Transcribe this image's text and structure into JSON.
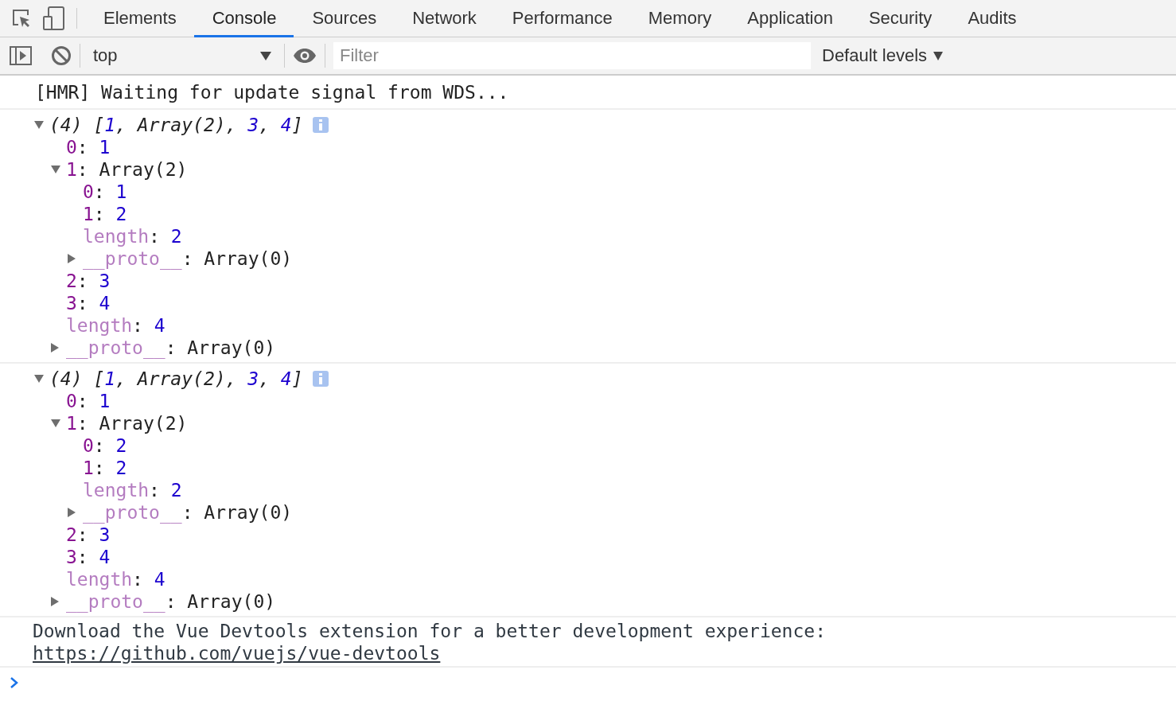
{
  "tabs": [
    {
      "label": "Elements",
      "selected": false
    },
    {
      "label": "Console",
      "selected": true
    },
    {
      "label": "Sources",
      "selected": false
    },
    {
      "label": "Network",
      "selected": false
    },
    {
      "label": "Performance",
      "selected": false
    },
    {
      "label": "Memory",
      "selected": false
    },
    {
      "label": "Application",
      "selected": false
    },
    {
      "label": "Security",
      "selected": false
    },
    {
      "label": "Audits",
      "selected": false
    }
  ],
  "toolbar": {
    "context": "top",
    "filter": {
      "placeholder": "Filter"
    },
    "levels": "Default levels"
  },
  "messages": [
    {
      "kind": "log",
      "text": "[HMR] Waiting for update signal from WDS..."
    },
    {
      "kind": "object",
      "expanded": true,
      "summary": [
        {
          "kind": "punct",
          "text": "(4) ["
        },
        {
          "kind": "number",
          "text": "1"
        },
        {
          "kind": "punct",
          "text": ", "
        },
        {
          "kind": "object",
          "text": "Array(2)"
        },
        {
          "kind": "punct",
          "text": ", "
        },
        {
          "kind": "number",
          "text": "3"
        },
        {
          "kind": "punct",
          "text": ", "
        },
        {
          "kind": "number",
          "text": "4"
        },
        {
          "kind": "punct",
          "text": "]"
        }
      ],
      "children": [
        {
          "parts": [
            {
              "kind": "key",
              "text": "0"
            },
            {
              "kind": "punct",
              "text": ": "
            },
            {
              "kind": "number",
              "text": "1"
            }
          ]
        },
        {
          "expanded": true,
          "parts": [
            {
              "kind": "key",
              "text": "1"
            },
            {
              "kind": "punct",
              "text": ": "
            },
            {
              "kind": "object",
              "text": "Array(2)"
            }
          ],
          "children": [
            {
              "parts": [
                {
                  "kind": "key",
                  "text": "0"
                },
                {
                  "kind": "punct",
                  "text": ": "
                },
                {
                  "kind": "number",
                  "text": "1"
                }
              ]
            },
            {
              "parts": [
                {
                  "kind": "key",
                  "text": "1"
                },
                {
                  "kind": "punct",
                  "text": ": "
                },
                {
                  "kind": "number",
                  "text": "2"
                }
              ]
            },
            {
              "parts": [
                {
                  "kind": "hidden_key",
                  "text": "length"
                },
                {
                  "kind": "punct",
                  "text": ": "
                },
                {
                  "kind": "number",
                  "text": "2"
                }
              ]
            },
            {
              "expanded": false,
              "parts": [
                {
                  "kind": "hidden_key",
                  "text": "__proto__"
                },
                {
                  "kind": "punct",
                  "text": ": "
                },
                {
                  "kind": "object",
                  "text": "Array(0)"
                }
              ]
            }
          ]
        },
        {
          "parts": [
            {
              "kind": "key",
              "text": "2"
            },
            {
              "kind": "punct",
              "text": ": "
            },
            {
              "kind": "number",
              "text": "3"
            }
          ]
        },
        {
          "parts": [
            {
              "kind": "key",
              "text": "3"
            },
            {
              "kind": "punct",
              "text": ": "
            },
            {
              "kind": "number",
              "text": "4"
            }
          ]
        },
        {
          "parts": [
            {
              "kind": "hidden_key",
              "text": "length"
            },
            {
              "kind": "punct",
              "text": ": "
            },
            {
              "kind": "number",
              "text": "4"
            }
          ]
        },
        {
          "expanded": false,
          "parts": [
            {
              "kind": "hidden_key",
              "text": "__proto__"
            },
            {
              "kind": "punct",
              "text": ": "
            },
            {
              "kind": "object",
              "text": "Array(0)"
            }
          ]
        }
      ]
    },
    {
      "kind": "object",
      "expanded": true,
      "summary": [
        {
          "kind": "punct",
          "text": "(4) ["
        },
        {
          "kind": "number",
          "text": "1"
        },
        {
          "kind": "punct",
          "text": ", "
        },
        {
          "kind": "object",
          "text": "Array(2)"
        },
        {
          "kind": "punct",
          "text": ", "
        },
        {
          "kind": "number",
          "text": "3"
        },
        {
          "kind": "punct",
          "text": ", "
        },
        {
          "kind": "number",
          "text": "4"
        },
        {
          "kind": "punct",
          "text": "]"
        }
      ],
      "children": [
        {
          "parts": [
            {
              "kind": "key",
              "text": "0"
            },
            {
              "kind": "punct",
              "text": ": "
            },
            {
              "kind": "number",
              "text": "1"
            }
          ]
        },
        {
          "expanded": true,
          "parts": [
            {
              "kind": "key",
              "text": "1"
            },
            {
              "kind": "punct",
              "text": ": "
            },
            {
              "kind": "object",
              "text": "Array(2)"
            }
          ],
          "children": [
            {
              "parts": [
                {
                  "kind": "key",
                  "text": "0"
                },
                {
                  "kind": "punct",
                  "text": ": "
                },
                {
                  "kind": "number",
                  "text": "2"
                }
              ]
            },
            {
              "parts": [
                {
                  "kind": "key",
                  "text": "1"
                },
                {
                  "kind": "punct",
                  "text": ": "
                },
                {
                  "kind": "number",
                  "text": "2"
                }
              ]
            },
            {
              "parts": [
                {
                  "kind": "hidden_key",
                  "text": "length"
                },
                {
                  "kind": "punct",
                  "text": ": "
                },
                {
                  "kind": "number",
                  "text": "2"
                }
              ]
            },
            {
              "expanded": false,
              "parts": [
                {
                  "kind": "hidden_key",
                  "text": "__proto__"
                },
                {
                  "kind": "punct",
                  "text": ": "
                },
                {
                  "kind": "object",
                  "text": "Array(0)"
                }
              ]
            }
          ]
        },
        {
          "parts": [
            {
              "kind": "key",
              "text": "2"
            },
            {
              "kind": "punct",
              "text": ": "
            },
            {
              "kind": "number",
              "text": "3"
            }
          ]
        },
        {
          "parts": [
            {
              "kind": "key",
              "text": "3"
            },
            {
              "kind": "punct",
              "text": ": "
            },
            {
              "kind": "number",
              "text": "4"
            }
          ]
        },
        {
          "parts": [
            {
              "kind": "hidden_key",
              "text": "length"
            },
            {
              "kind": "punct",
              "text": ": "
            },
            {
              "kind": "number",
              "text": "4"
            }
          ]
        },
        {
          "expanded": false,
          "parts": [
            {
              "kind": "hidden_key",
              "text": "__proto__"
            },
            {
              "kind": "punct",
              "text": ": "
            },
            {
              "kind": "object",
              "text": "Array(0)"
            }
          ]
        }
      ]
    },
    {
      "kind": "log_link",
      "text": "Download the Vue Devtools extension for a better development experience:",
      "link": "https://github.com/vuejs/vue-devtools"
    }
  ]
}
